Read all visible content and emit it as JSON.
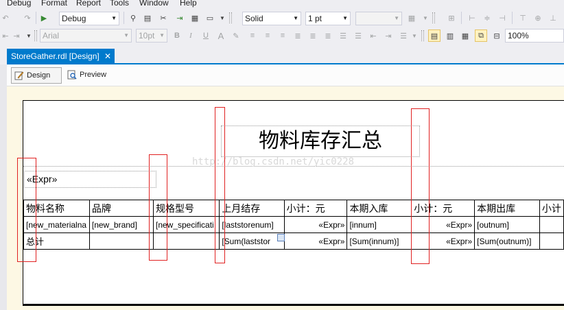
{
  "menu": [
    "Debug",
    "Format",
    "Report",
    "Tools",
    "Window",
    "Help"
  ],
  "toolbar1": {
    "config_value": "Debug",
    "border_style": "Solid",
    "border_width": "1 pt",
    "border_color": ""
  },
  "toolbar2": {
    "font_name": "Arial",
    "font_size": "10pt",
    "bold": "B",
    "italic": "I",
    "underline": "U",
    "font_color": "A",
    "zoom": "100%"
  },
  "document_tab": {
    "title": "StoreGather.rdl [Design]",
    "close": "✕"
  },
  "view_tabs": {
    "design": "Design",
    "preview": "Preview"
  },
  "report": {
    "title": "物料库存汇总",
    "param_expr": "«Expr»",
    "watermark": "http://blog.csdn.net/yic0228",
    "table": {
      "header": [
        "物料名称",
        "品牌",
        "规格型号",
        "上月结存",
        "小计：元",
        "本期入库",
        "小计：元",
        "本期出库",
        "小计"
      ],
      "detail": [
        "[new_materialna",
        "[new_brand]",
        "[new_specificati",
        "[laststorenum]",
        "«Expr»",
        "[innum]",
        "«Expr»",
        "[outnum]",
        ""
      ],
      "total": [
        "总计",
        "",
        "",
        "[Sum(laststor",
        "«Expr»",
        "[Sum(innum)]",
        "«Expr»",
        "[Sum(outnum)]",
        ""
      ]
    }
  }
}
